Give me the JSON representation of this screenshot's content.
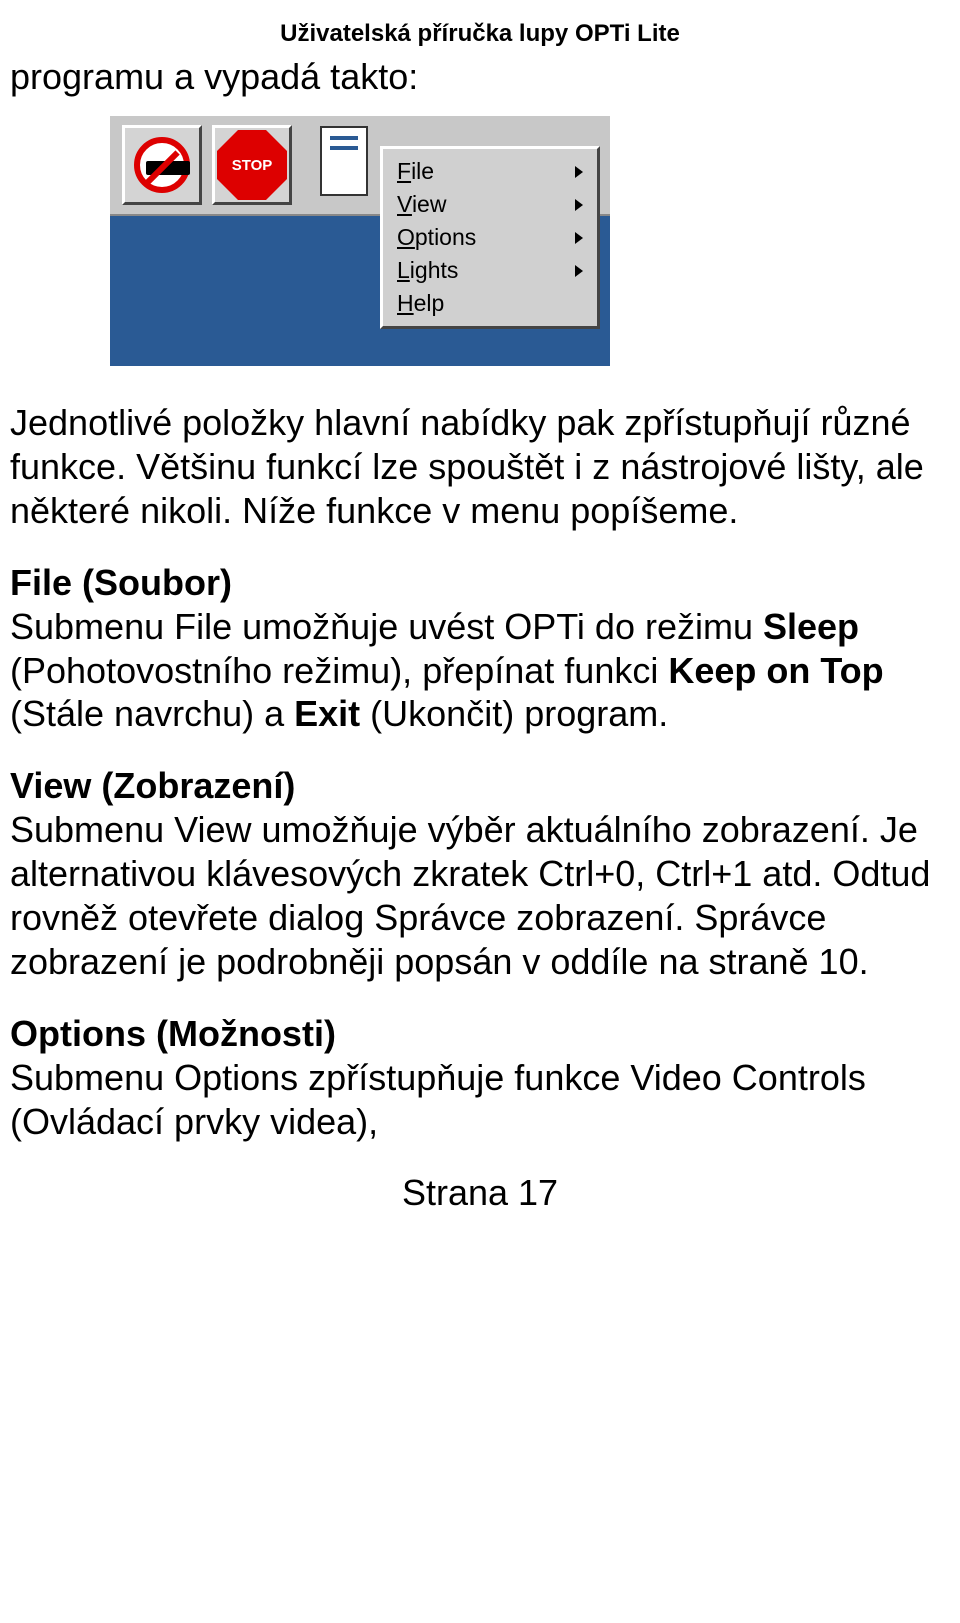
{
  "header": "Uživatelská příručka lupy OPTi Lite",
  "intro": "programu a vypadá takto:",
  "menu": {
    "items": [
      {
        "underline": "F",
        "rest": "ile",
        "arrow": true
      },
      {
        "underline": "V",
        "rest": "iew",
        "arrow": true
      },
      {
        "underline": "O",
        "rest": "ptions",
        "arrow": true
      },
      {
        "underline": "L",
        "rest": "ights",
        "arrow": true
      },
      {
        "underline": "H",
        "rest": "elp",
        "arrow": false
      }
    ],
    "stop_label": "STOP"
  },
  "para1": "Jednotlivé položky hlavní nabídky pak zpřístupňují různé funkce. Většinu funkcí lze spouštět i z nástrojové lišty, ale některé nikoli. Níže funkce v menu popíšeme.",
  "sections": {
    "file": {
      "title": "File (Soubor)",
      "body_a": "Submenu File umožňuje uvést OPTi do režimu ",
      "b1": "Sleep",
      "body_b": " (Pohotovostního režimu), přepínat funkci ",
      "b2": "Keep on Top",
      "body_c": " (Stále navrchu) a ",
      "b3": "Exit",
      "body_d": " (Ukončit) program."
    },
    "view": {
      "title": "View (Zobrazení)",
      "body": "Submenu View umožňuje výběr aktuálního zobrazení. Je alternativou klávesových zkratek Ctrl+0, Ctrl+1 atd. Odtud rovněž otevřete dialog Správce zobrazení. Správce zobrazení je podrobněji popsán v oddíle na straně 10."
    },
    "options": {
      "title": "Options (Možnosti)",
      "body": "Submenu Options zpřístupňuje funkce Video Controls (Ovládací prvky videa),"
    }
  },
  "page": "Strana 17"
}
